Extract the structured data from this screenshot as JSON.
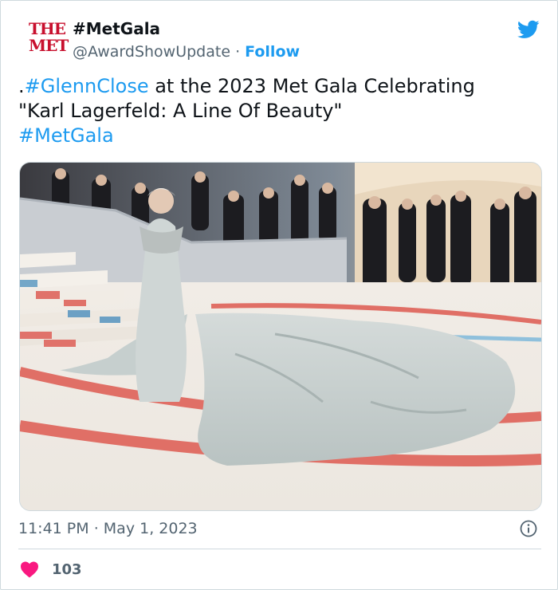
{
  "account": {
    "avatar_line1": "THE",
    "avatar_line2": "MET",
    "display_name": "#MetGala",
    "handle": "@AwardShowUpdate",
    "separator": " · ",
    "follow_label": "Follow"
  },
  "tweet": {
    "prefix": ".",
    "hashtag1": "#GlennClose",
    "text1": " at the 2023 Met Gala Celebrating\n\"Karl Lagerfeld: A Line Of Beauty\"\n",
    "hashtag2": "#MetGala"
  },
  "meta": {
    "time": "11:41 PM",
    "separator": " · ",
    "date": "May 1, 2023"
  },
  "engagement": {
    "likes": "103"
  },
  "icons": {
    "brand": "twitter-bird-icon",
    "info": "info-icon",
    "like": "heart-icon"
  },
  "colors": {
    "accent": "#1d9bf0",
    "heart": "#f91880",
    "met_red": "#c8102e",
    "muted": "#536471"
  }
}
